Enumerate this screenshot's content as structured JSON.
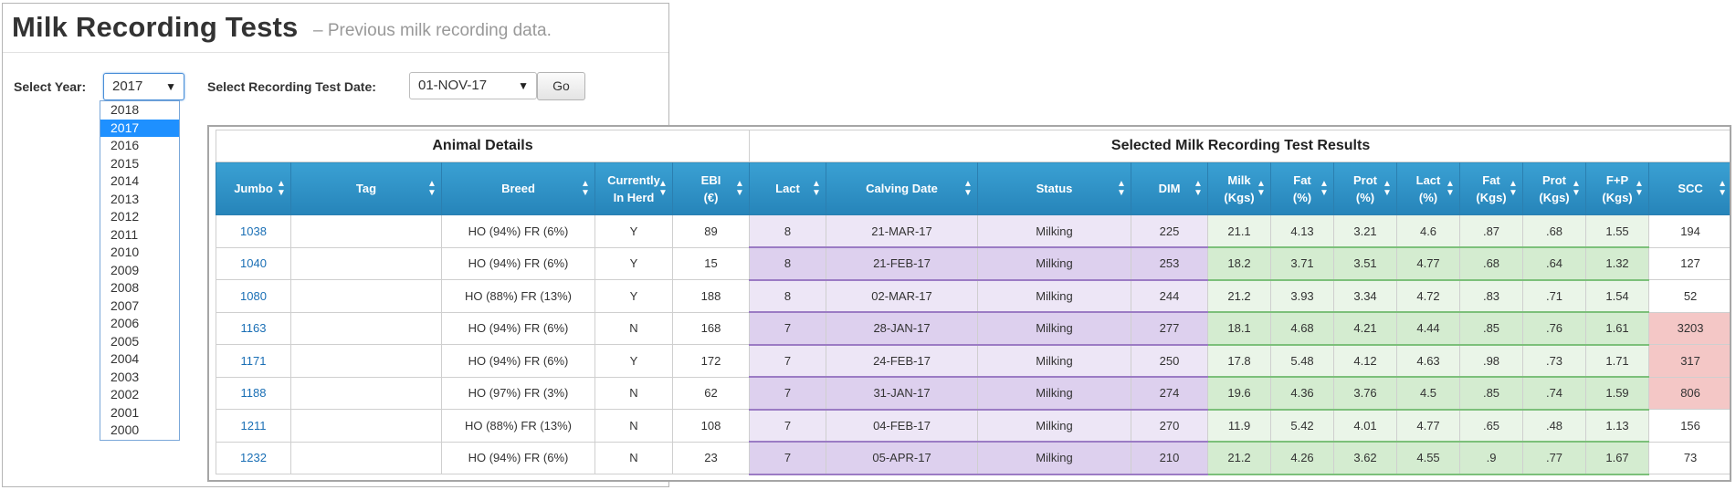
{
  "page": {
    "title": "Milk Recording Tests",
    "subtitle": "– Previous milk recording data."
  },
  "controls": {
    "year_label": "Select Year:",
    "year_value": "2017",
    "test_date_label": "Select Recording Test Date:",
    "test_date_value": "01-NOV-17",
    "go_label": "Go"
  },
  "year_options": [
    "2018",
    "2017",
    "2016",
    "2015",
    "2014",
    "2013",
    "2012",
    "2011",
    "2010",
    "2009",
    "2008",
    "2007",
    "2006",
    "2005",
    "2004",
    "2003",
    "2002",
    "2001",
    "2000"
  ],
  "year_selected_index": 1,
  "table": {
    "group_headers": [
      "Animal Details",
      "Selected Milk Recording Test Results"
    ],
    "columns": [
      {
        "top": "Jumbo",
        "bottom": ""
      },
      {
        "top": "Tag",
        "bottom": ""
      },
      {
        "top": "Breed",
        "bottom": ""
      },
      {
        "top": "Currently",
        "bottom": "In Herd"
      },
      {
        "top": "EBI",
        "bottom": "(€)"
      },
      {
        "top": "Lact",
        "bottom": ""
      },
      {
        "top": "Calving Date",
        "bottom": ""
      },
      {
        "top": "Status",
        "bottom": ""
      },
      {
        "top": "DIM",
        "bottom": ""
      },
      {
        "top": "Milk",
        "bottom": "(Kgs)"
      },
      {
        "top": "Fat",
        "bottom": "(%)"
      },
      {
        "top": "Prot",
        "bottom": "(%)"
      },
      {
        "top": "Lact",
        "bottom": "(%)"
      },
      {
        "top": "Fat",
        "bottom": "(Kgs)"
      },
      {
        "top": "Prot",
        "bottom": "(Kgs)"
      },
      {
        "top": "F+P",
        "bottom": "(Kgs)"
      },
      {
        "top": "SCC",
        "bottom": ""
      }
    ],
    "rows": [
      [
        "1038",
        "",
        "HO (94%) FR (6%)",
        "Y",
        "89",
        "8",
        "21-MAR-17",
        "Milking",
        "225",
        "21.1",
        "4.13",
        "3.21",
        "4.6",
        ".87",
        ".68",
        "1.55",
        "194"
      ],
      [
        "1040",
        "",
        "HO (94%) FR (6%)",
        "Y",
        "15",
        "8",
        "21-FEB-17",
        "Milking",
        "253",
        "18.2",
        "3.71",
        "3.51",
        "4.77",
        ".68",
        ".64",
        "1.32",
        "127"
      ],
      [
        "1080",
        "",
        "HO (88%) FR (13%)",
        "Y",
        "188",
        "8",
        "02-MAR-17",
        "Milking",
        "244",
        "21.2",
        "3.93",
        "3.34",
        "4.72",
        ".83",
        ".71",
        "1.54",
        "52"
      ],
      [
        "1163",
        "",
        "HO (94%) FR (6%)",
        "N",
        "168",
        "7",
        "28-JAN-17",
        "Milking",
        "277",
        "18.1",
        "4.68",
        "4.21",
        "4.44",
        ".85",
        ".76",
        "1.61",
        "3203"
      ],
      [
        "1171",
        "",
        "HO (94%) FR (6%)",
        "Y",
        "172",
        "7",
        "24-FEB-17",
        "Milking",
        "250",
        "17.8",
        "5.48",
        "4.12",
        "4.63",
        ".98",
        ".73",
        "1.71",
        "317"
      ],
      [
        "1188",
        "",
        "HO (97%) FR (3%)",
        "N",
        "62",
        "7",
        "31-JAN-17",
        "Milking",
        "274",
        "19.6",
        "4.36",
        "3.76",
        "4.5",
        ".85",
        ".74",
        "1.59",
        "806"
      ],
      [
        "1211",
        "",
        "HO (88%) FR (13%)",
        "N",
        "108",
        "7",
        "04-FEB-17",
        "Milking",
        "270",
        "11.9",
        "5.42",
        "4.01",
        "4.77",
        ".65",
        ".48",
        "1.13",
        "156"
      ],
      [
        "1232",
        "",
        "HO (94%) FR (6%)",
        "N",
        "23",
        "7",
        "05-APR-17",
        "Milking",
        "210",
        "21.2",
        "4.26",
        "3.62",
        "4.55",
        ".9",
        ".77",
        "1.67",
        "73"
      ]
    ],
    "scc_highlight_rows": [
      3,
      4,
      5
    ],
    "colors": {
      "header_blue": "#2e8fc5",
      "purple_cells": "#ede6f6",
      "green_cells": "#eaf5e8",
      "scc_alert": "#f4c7c6",
      "link_blue": "#1a6fb5"
    }
  }
}
